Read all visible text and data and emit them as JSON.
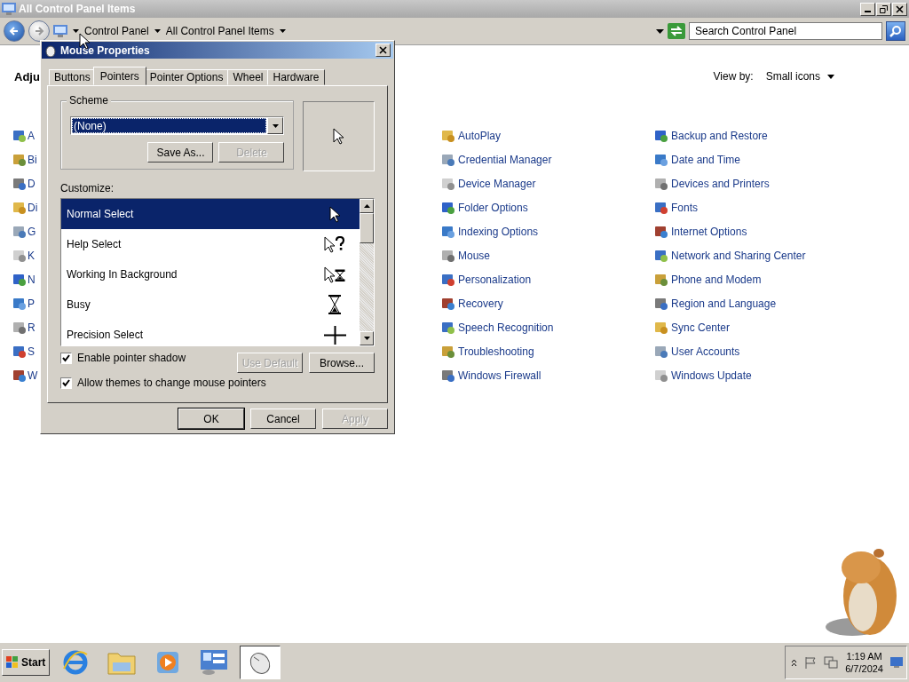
{
  "window": {
    "title": "All Control Panel Items"
  },
  "address_bar": {
    "breadcrumbs": [
      "Control Panel",
      "All Control Panel Items"
    ]
  },
  "search": {
    "placeholder": "Search Control Panel"
  },
  "content": {
    "heading": "Adju",
    "view_by_label": "View by:",
    "view_by_value": "Small icons",
    "columns": [
      [
        "A",
        "Bi",
        "D",
        "Di",
        "G",
        "K",
        "N",
        "P",
        "R",
        "S",
        "W"
      ],
      [
        "AutoPlay",
        "Credential Manager",
        "Device Manager",
        "Folder Options",
        "Indexing Options",
        "Mouse",
        "Personalization",
        "Recovery",
        "Speech Recognition",
        "Troubleshooting",
        "Windows Firewall"
      ],
      [
        "Backup and Restore",
        "Date and Time",
        "Devices and Printers",
        "Fonts",
        "Internet Options",
        "Network and Sharing Center",
        "Phone and Modem",
        "Region and Language",
        "Sync Center",
        "User Accounts",
        "Windows Update"
      ]
    ]
  },
  "dialog": {
    "title": "Mouse Properties",
    "tabs": [
      {
        "label": "Buttons",
        "selected": false
      },
      {
        "label": "Pointers",
        "selected": true
      },
      {
        "label": "Pointer Options",
        "selected": false
      },
      {
        "label": "Wheel",
        "selected": false
      },
      {
        "label": "Hardware",
        "selected": false
      }
    ],
    "scheme": {
      "label": "Scheme",
      "value": "(None)",
      "buttons": [
        {
          "label": "Save As...",
          "disabled": false
        },
        {
          "label": "Delete",
          "disabled": true
        }
      ]
    },
    "customize_label": "Customize:",
    "pointers": [
      {
        "name": "Normal Select",
        "kind": "arrow",
        "selected": true
      },
      {
        "name": "Help Select",
        "kind": "help",
        "selected": false
      },
      {
        "name": "Working In Background",
        "kind": "working",
        "selected": false
      },
      {
        "name": "Busy",
        "kind": "busy",
        "selected": false
      },
      {
        "name": "Precision Select",
        "kind": "cross",
        "selected": false
      }
    ],
    "checkboxes": [
      {
        "label": "Enable pointer shadow",
        "checked": true
      },
      {
        "label": "Allow themes to change mouse pointers",
        "checked": true
      }
    ],
    "list_buttons": [
      {
        "label": "Use Default",
        "disabled": true
      },
      {
        "label": "Browse...",
        "disabled": false
      }
    ],
    "buttons": [
      {
        "label": "OK",
        "disabled": false
      },
      {
        "label": "Cancel",
        "disabled": false
      },
      {
        "label": "Apply",
        "disabled": true
      }
    ]
  },
  "taskbar": {
    "start": "Start",
    "apps": [
      {
        "selected": false
      },
      {
        "selected": false
      },
      {
        "selected": false
      },
      {
        "selected": false
      },
      {
        "selected": true
      }
    ],
    "clock": {
      "time": "1:19 AM",
      "date": "6/7/2024"
    }
  }
}
